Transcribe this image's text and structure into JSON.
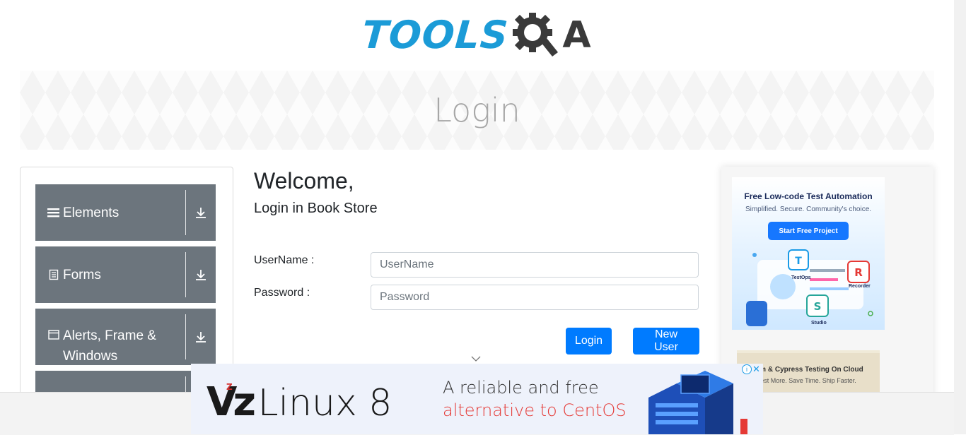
{
  "logo": {
    "tools": "TOOLS",
    "q": "Q",
    "a": "A"
  },
  "banner": {
    "title": "Login"
  },
  "sidebar": {
    "groups": [
      {
        "label": "Elements",
        "icon": "hamburger-icon"
      },
      {
        "label": "Forms",
        "icon": "document-icon"
      },
      {
        "label": "Alerts, Frame & Windows",
        "icon": "window-icon"
      },
      {
        "label": "",
        "icon": ""
      }
    ]
  },
  "main": {
    "welcome": "Welcome,",
    "subtitle": "Login in Book Store",
    "username_label": "UserName :",
    "username_placeholder": "UserName",
    "password_label": "Password :",
    "password_placeholder": "Password",
    "login_button": "Login",
    "new_user_button": "New User"
  },
  "ads": {
    "ad1_title": "Free Low-code Test Automation",
    "ad1_sub": "Simplified. Secure. Community's choice.",
    "ad1_button": "Start Free Project",
    "ad1_testops": "TestOps",
    "ad1_recorder": "Recorder",
    "ad1_studio": "Studio",
    "ad2_title": "ium & Cypress Testing On Cloud",
    "ad2_sub": "est More. Save Time. Ship Faster."
  },
  "bottom_ad": {
    "brand_sup": "Z",
    "brand_v": "Vz",
    "brand_name": "Linux 8",
    "line1": "A reliable and free",
    "line2": "alternative to CentOS",
    "info": "i",
    "close": "✕"
  },
  "colors": {
    "primary": "#007bff",
    "sidebar": "#6c757d",
    "logo_blue": "#1b9bd7"
  }
}
